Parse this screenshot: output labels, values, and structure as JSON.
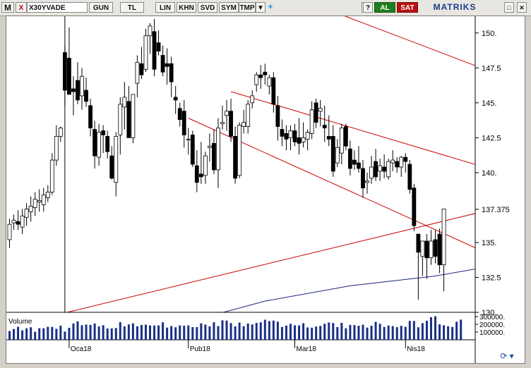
{
  "toolbar": {
    "m_label": "M",
    "close_label": "X",
    "symbol": "X30YVADE",
    "buttons": [
      "GUN",
      "TL",
      "LIN",
      "KHN",
      "SVD",
      "SYM",
      "TMP"
    ],
    "dropdown_icon": "triangle-down-icon",
    "twitter_icon": "bird-icon",
    "refresh_label": "G",
    "help_label": "?",
    "buy_label": "AL",
    "sell_label": "SAT",
    "brand": "MATRIKS",
    "minimize_label": "□",
    "close_window_label": "✕",
    "colors": {
      "buy": "#1e7d1e",
      "sell": "#b81010",
      "brand": "#1a3a8c"
    }
  },
  "volume_label": "Volume",
  "chart_data": {
    "type": "candlestick",
    "y_ticks": [
      "150.",
      "147.5",
      "145.",
      "142.5",
      "140.",
      "137.375",
      "135.",
      "132.5",
      "130."
    ],
    "ylim": [
      130,
      151.2
    ],
    "x_ticks": [
      "Oca18",
      "Pub18",
      "Mar18",
      "Nis18"
    ],
    "volume_ticks": [
      "300000.",
      "200000.",
      "100000."
    ],
    "grid": false,
    "candles": [
      [
        135.2,
        136.7,
        134.6,
        136.3
      ],
      [
        136.4,
        137.0,
        135.9,
        136.6
      ],
      [
        136.5,
        137.3,
        135.9,
        136.3
      ],
      [
        136.1,
        137.4,
        135.6,
        136.9
      ],
      [
        136.8,
        137.8,
        136.2,
        137.4
      ],
      [
        137.2,
        138.3,
        136.5,
        137.6
      ],
      [
        137.5,
        138.6,
        136.9,
        138.1
      ],
      [
        137.9,
        138.8,
        137.2,
        138.0
      ],
      [
        137.7,
        138.9,
        137.2,
        138.4
      ],
      [
        138.2,
        139.1,
        137.9,
        138.6
      ],
      [
        138.6,
        141.4,
        138.4,
        140.9
      ],
      [
        140.9,
        143.4,
        140.5,
        142.6
      ],
      [
        142.6,
        143.3,
        142.2,
        143.2
      ],
      [
        148.6,
        149.1,
        144.8,
        145.9
      ],
      [
        148.2,
        150.4,
        147.0,
        145.6
      ],
      [
        146.0,
        146.9,
        144.1,
        145.8
      ],
      [
        146.6,
        147.9,
        144.9,
        145.2
      ],
      [
        145.5,
        147.5,
        144.5,
        146.9
      ],
      [
        145.9,
        146.8,
        144.7,
        145.1
      ],
      [
        144.8,
        145.3,
        142.6,
        143.2
      ],
      [
        143.1,
        143.7,
        140.3,
        141.2
      ],
      [
        141.1,
        143.5,
        140.5,
        142.9
      ],
      [
        143.0,
        143.4,
        141.4,
        142.7
      ],
      [
        142.6,
        143.0,
        141.0,
        141.5
      ],
      [
        141.2,
        141.9,
        139.5,
        139.6
      ],
      [
        139.3,
        142.9,
        138.3,
        142.6
      ],
      [
        142.7,
        145.4,
        141.3,
        144.9
      ],
      [
        144.7,
        146.5,
        143.1,
        145.4
      ],
      [
        145.1,
        146.2,
        142.5,
        142.5
      ],
      [
        142.5,
        145.6,
        142.1,
        145.6
      ],
      [
        146.4,
        148.4,
        145.4,
        147.9
      ],
      [
        147.8,
        149.0,
        146.7,
        147.0
      ],
      [
        147.4,
        150.3,
        147.2,
        149.8
      ],
      [
        149.8,
        150.7,
        148.5,
        150.5
      ],
      [
        150.1,
        151.0,
        146.9,
        147.4
      ],
      [
        149.3,
        150.2,
        148.4,
        148.7
      ],
      [
        148.4,
        149.1,
        146.9,
        147.2
      ],
      [
        147.8,
        148.9,
        146.3,
        147.6
      ],
      [
        147.8,
        148.3,
        145.4,
        146.5
      ],
      [
        145.4,
        146.2,
        144.2,
        145.2
      ],
      [
        144.6,
        145.0,
        143.3,
        143.8
      ],
      [
        144.4,
        145.2,
        141.8,
        142.7
      ],
      [
        142.4,
        143.2,
        141.3,
        142.4
      ],
      [
        142.7,
        143.0,
        140.4,
        140.6
      ],
      [
        140.5,
        141.6,
        138.6,
        139.3
      ],
      [
        139.9,
        142.2,
        139.2,
        139.7
      ],
      [
        139.8,
        141.5,
        139.2,
        141.2
      ],
      [
        141.8,
        142.8,
        140.8,
        141.9
      ],
      [
        142.1,
        143.1,
        139.9,
        140.2
      ],
      [
        140.2,
        143.9,
        138.9,
        143.2
      ],
      [
        143.5,
        144.8,
        143.1,
        143.6
      ],
      [
        144.1,
        145.2,
        143.0,
        144.4
      ],
      [
        144.4,
        145.3,
        142.2,
        142.6
      ],
      [
        142.6,
        143.3,
        139.2,
        139.6
      ],
      [
        139.8,
        143.6,
        139.6,
        143.4
      ],
      [
        143.3,
        144.5,
        142.8,
        143.6
      ],
      [
        143.3,
        145.2,
        142.8,
        144.9
      ],
      [
        145.0,
        145.9,
        144.6,
        145.5
      ],
      [
        146.3,
        147.2,
        145.8,
        147.0
      ],
      [
        147.0,
        147.7,
        146.0,
        146.8
      ],
      [
        147.2,
        147.8,
        146.3,
        147.0
      ],
      [
        146.2,
        147.0,
        145.6,
        146.8
      ],
      [
        146.8,
        147.2,
        144.3,
        144.9
      ],
      [
        144.8,
        145.5,
        142.3,
        143.3
      ],
      [
        143.1,
        143.8,
        141.9,
        142.6
      ],
      [
        142.8,
        143.4,
        141.6,
        142.4
      ],
      [
        142.5,
        143.4,
        141.6,
        143.0
      ],
      [
        143.0,
        143.5,
        141.9,
        142.2
      ],
      [
        142.5,
        143.9,
        141.3,
        142.1
      ],
      [
        142.2,
        143.6,
        141.8,
        142.5
      ],
      [
        142.4,
        143.1,
        141.6,
        142.9
      ],
      [
        142.8,
        145.1,
        142.4,
        144.5
      ],
      [
        145.0,
        145.3,
        143.2,
        143.6
      ],
      [
        144.4,
        145.2,
        143.3,
        144.6
      ],
      [
        143.4,
        144.8,
        142.2,
        143.2
      ],
      [
        142.6,
        144.1,
        141.9,
        142.4
      ],
      [
        142.6,
        143.4,
        139.7,
        140.1
      ],
      [
        140.7,
        142.4,
        140.4,
        141.8
      ],
      [
        141.4,
        143.5,
        140.6,
        143.2
      ],
      [
        143.3,
        143.5,
        141.6,
        141.9
      ],
      [
        141.7,
        142.3,
        139.8,
        140.3
      ],
      [
        140.9,
        141.6,
        140.2,
        140.6
      ],
      [
        140.7,
        141.9,
        140.0,
        140.3
      ],
      [
        140.3,
        140.9,
        138.2,
        138.9
      ],
      [
        139.3,
        140.0,
        138.5,
        139.4
      ],
      [
        139.6,
        141.2,
        139.2,
        140.4
      ],
      [
        140.8,
        141.7,
        139.4,
        139.7
      ],
      [
        140.1,
        141.0,
        139.4,
        140.5
      ],
      [
        140.4,
        141.3,
        139.6,
        140.1
      ],
      [
        139.7,
        141.0,
        139.5,
        140.8
      ],
      [
        140.7,
        141.6,
        140.1,
        140.9
      ],
      [
        140.8,
        141.1,
        140.0,
        140.4
      ],
      [
        140.4,
        141.2,
        139.7,
        141.1
      ],
      [
        141.1,
        141.4,
        140.0,
        140.8
      ],
      [
        140.6,
        140.9,
        138.5,
        138.8
      ],
      [
        138.9,
        139.2,
        135.8,
        136.2
      ],
      [
        135.6,
        135.6,
        130.9,
        134.3
      ],
      [
        134.0,
        135.1,
        132.6,
        135.1
      ],
      [
        135.1,
        135.6,
        132.4,
        133.9
      ],
      [
        133.9,
        135.9,
        133.4,
        135.1
      ],
      [
        135.2,
        135.9,
        133.5,
        134.0
      ],
      [
        135.6,
        136.0,
        132.8,
        133.4
      ],
      [
        133.4,
        135.6,
        131.5,
        137.4
      ]
    ],
    "volumes": [
      114000,
      140000,
      168000,
      122000,
      148000,
      162000,
      104000,
      150000,
      149000,
      168000,
      166000,
      142000,
      183000,
      107000,
      155000,
      211000,
      239000,
      189000,
      197000,
      193000,
      211000,
      173000,
      189000,
      146000,
      148000,
      152000,
      228000,
      174000,
      199000,
      213000,
      174000,
      191000,
      196000,
      186000,
      185000,
      186000,
      226000,
      158000,
      178000,
      162000,
      186000,
      182000,
      186000,
      164000,
      164000,
      213000,
      196000,
      174000,
      227000,
      177000,
      252000,
      248000,
      216000,
      174000,
      223000,
      177000,
      211000,
      199000,
      218000,
      226000,
      260000,
      242000,
      249000,
      235000,
      166000,
      184000,
      207000,
      188000,
      186000,
      214000,
      160000,
      157000,
      172000,
      179000,
      207000,
      224000,
      217000,
      165000,
      220000,
      149000,
      192000,
      190000,
      182000,
      195000,
      158000,
      182000,
      232000,
      207000,
      166000,
      185000,
      177000,
      163000,
      181000,
      168000,
      245000,
      244000,
      162000,
      215000,
      246000,
      292000,
      304000,
      200000,
      188000,
      175000,
      166000,
      233000,
      261000
    ],
    "moving_average": [
      [
        38,
        129.0
      ],
      [
        60,
        130.8
      ],
      [
        80,
        131.9
      ],
      [
        100,
        132.6
      ],
      [
        115,
        133.4
      ],
      [
        135,
        134.0
      ],
      [
        150,
        134.8
      ],
      [
        158,
        135.0
      ],
      [
        168,
        135.0
      ]
    ],
    "trend_lines": [
      [
        [
          0,
          129.0
        ],
        [
          172,
          141.7
        ]
      ],
      [
        [
          59,
          153.5
        ],
        [
          172,
          140.4
        ]
      ],
      [
        [
          52,
          145.8
        ],
        [
          172,
          134.9
        ]
      ],
      [
        [
          42,
          143.9
        ],
        [
          172,
          126.0
        ]
      ]
    ],
    "vertical_line_at": 13,
    "colors": {
      "candle_up": "#ffffff",
      "candle_down": "#000000",
      "trend": "#cc0000",
      "ma": "#1a237e",
      "volume": "#1a2f86"
    }
  }
}
